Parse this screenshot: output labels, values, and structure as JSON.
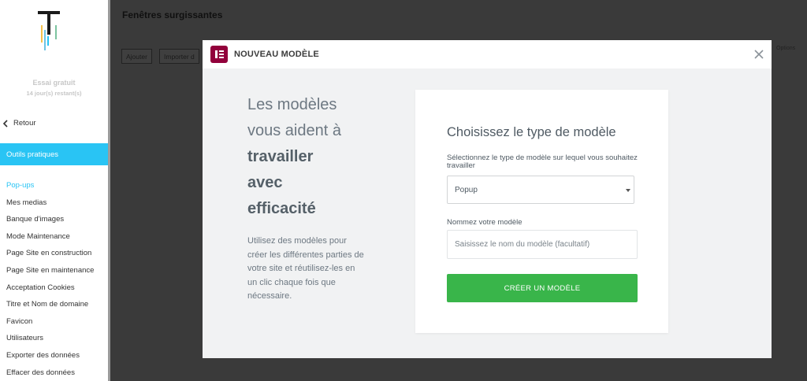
{
  "sidebar": {
    "trial_title": "Essai gratuit",
    "trial_days": "14 jour(s) restant(s)",
    "back_label": "Retour",
    "section_label": "Outils pratiques",
    "items": [
      {
        "label": "Pop-ups",
        "active": true
      },
      {
        "label": "Mes medias"
      },
      {
        "label": "Banque d'images"
      },
      {
        "label": "Mode Maintenance"
      },
      {
        "label": "Page Site en construction"
      },
      {
        "label": "Page Site en maintenance"
      },
      {
        "label": "Acceptation Cookies"
      },
      {
        "label": "Titre et Nom de domaine"
      },
      {
        "label": "Favicon"
      },
      {
        "label": "Utilisateurs"
      },
      {
        "label": "Exporter des données"
      },
      {
        "label": "Effacer des données"
      }
    ]
  },
  "background": {
    "page_title": "Fenêtres surgissantes",
    "add_button": "Ajouter",
    "import_button": "Importer d",
    "right_text": "Options"
  },
  "modal": {
    "title": "NOUVEAU MODÈLE",
    "promo": {
      "headline_line1": "Les modèles",
      "headline_line2": "vous aident à",
      "headline_bold1": "travailler",
      "headline_bold2": "avec",
      "headline_bold3": "efficacité",
      "text": "Utilisez des modèles pour créer les différentes parties de votre site et réutilisez-les en un clic chaque fois que nécessaire."
    },
    "form": {
      "title": "Choisissez le type de modèle",
      "type_label": "Sélectionnez le type de modèle sur lequel vous souhaitez travailler",
      "type_value": "Popup",
      "name_label": "Nommez votre modèle",
      "name_placeholder": "Saisissez le nom du modèle (facultatif)",
      "name_value": "",
      "submit_label": "CRÉER UN MODÈLE"
    }
  },
  "colors": {
    "accent": "#29c4f4",
    "brand": "#92003b",
    "success": "#39b54a",
    "overlay": "#3a3a3a"
  },
  "icons": {
    "logo": "brand-logo-icon",
    "back": "chevron-left-icon",
    "elementor": "elementor-icon",
    "close": "close-icon",
    "select": "caret-down-icon"
  }
}
